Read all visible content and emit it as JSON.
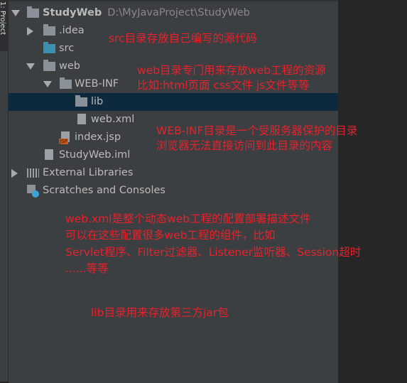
{
  "sidebar_tab": "1: Project",
  "tree": {
    "project": {
      "name": "StudyWeb",
      "path": "D:\\MyJavaProject\\StudyWeb"
    },
    "idea": ".idea",
    "src": "src",
    "web": "web",
    "webinf": "WEB-INF",
    "lib": "lib",
    "webxml": "web.xml",
    "indexjsp": "index.jsp",
    "iml": "StudyWeb.iml",
    "external": "External Libraries",
    "scratches": "Scratches and Consoles",
    "jsp_badge": "JSP"
  },
  "notes": {
    "src": "src目录存放自己编写的源代码",
    "web1": "web目录专门用来存放web工程的资源",
    "web2": "比如:html页面 css文件 js文件等等",
    "inf1": "WEB-INF目录是一个受服务器保护的目录",
    "inf2": "浏览器无法直接访问到此目录的内容",
    "xml1": "web.xml是整个动态web工程的配置部署描述文件",
    "xml2": "可以在这些配置很多web工程的组件，比如",
    "xml3": "Servlet程序、Filter过滤器、Listener监听器、Session超时",
    "xml4": "......等等",
    "lib": "lib目录用来存放第三方jar包"
  },
  "colors": {
    "annotation": "#e8212c",
    "selection": "#0d293e",
    "panel": "#3c3f41"
  }
}
